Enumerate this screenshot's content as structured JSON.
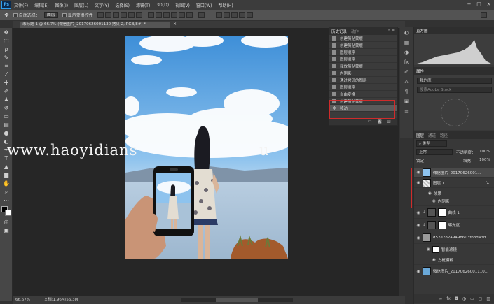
{
  "app": {
    "logo": "Ps"
  },
  "menubar": {
    "items": [
      "文件(F)",
      "编辑(E)",
      "图像(I)",
      "图层(L)",
      "文字(Y)",
      "选择(S)",
      "滤镜(T)",
      "3D(D)",
      "视图(V)",
      "窗口(W)",
      "帮助(H)"
    ],
    "window_controls": [
      "−",
      "□",
      "×"
    ]
  },
  "options": {
    "auto_select_label": "自动选择：",
    "auto_select_value": "图层",
    "transform_label": "显示变换控件"
  },
  "document": {
    "tab_label": "未标题-1 @ 66.7% (微信图片_20170626001130 拷贝 2, RGB/8#) *",
    "tab_close": "×"
  },
  "canvas": {
    "watermark": "www.haoyidians",
    "watermark_tail": "u"
  },
  "history": {
    "tabs": [
      "历史记录",
      "动作"
    ],
    "items": [
      "创建剪贴蒙版",
      "创建剪贴蒙版",
      "图层顺序",
      "图层顺序",
      "释放剪贴蒙版",
      "内阴影",
      "通过拷贝的图层",
      "图层顺序",
      "自由变换",
      "创建剪贴蒙版",
      "移动"
    ],
    "footer_icons": [
      "camera-icon",
      "trash-icon"
    ]
  },
  "histogram": {
    "tab": "直方图"
  },
  "adjustments": {
    "tab": "属性",
    "preset": "我的库",
    "search_placeholder": "搜索Adobe Stock"
  },
  "layers": {
    "tabs": [
      "图层",
      "通道",
      "路径"
    ],
    "kind_filter": "类型",
    "blend_mode": "正常",
    "opacity_label": "不透明度：",
    "opacity": "100%",
    "lock_label": "锁定：",
    "fill_label": "填充：",
    "fill": "100%",
    "rows": [
      {
        "name": "微信图片_20170626001...",
        "fx": ""
      },
      {
        "name": "图层 1",
        "fx": "fx"
      },
      {
        "name": "效果",
        "fx": ""
      },
      {
        "name": "内阴影",
        "fx": ""
      },
      {
        "name": "曲线 1",
        "fx": ""
      },
      {
        "name": "曝光度 1",
        "fx": ""
      },
      {
        "name": "d52e28249498603fb8d43d...",
        "fx": ""
      },
      {
        "name": "智能滤镜",
        "fx": ""
      },
      {
        "name": "方框模糊",
        "fx": ""
      },
      {
        "name": "微信图片_20170626001110...",
        "fx": ""
      }
    ]
  },
  "status": {
    "zoom": "66.67%",
    "doc": "文档:1.96M/56.3M"
  },
  "colors": {
    "highlight_box": "#d02b2b",
    "accent": "#2fa0f0"
  }
}
